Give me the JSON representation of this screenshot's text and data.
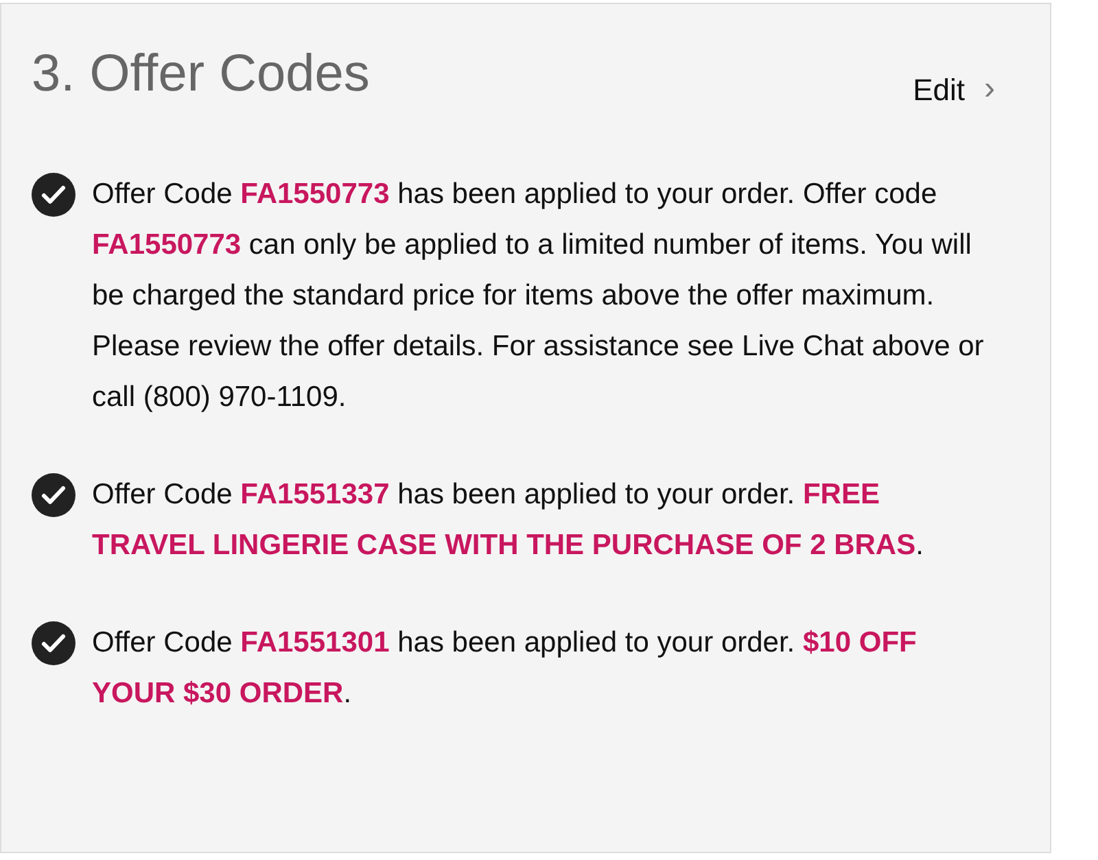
{
  "section": {
    "title": "3. Offer Codes",
    "edit_link": "Edit",
    "chevron": "›"
  },
  "offers": [
    {
      "message": "Offer Code **FA1550773** has been applied to your order. Offer code **FA1550773** can only be applied to a limited number of items. You will be charged the standard price for items above the offer maximum. Please review the offer details. For assistance see Live Chat above or call (800) 970-1109."
    },
    {
      "message": "Offer Code **FA1551337** has been applied to your order. **FREE TRAVEL LINGERIE CASE WITH THE PURCHASE OF 2 BRAS**."
    },
    {
      "message": "Offer Code **FA1551301** has been applied to your order. **$10 OFF YOUR $30 ORDER**."
    }
  ]
}
